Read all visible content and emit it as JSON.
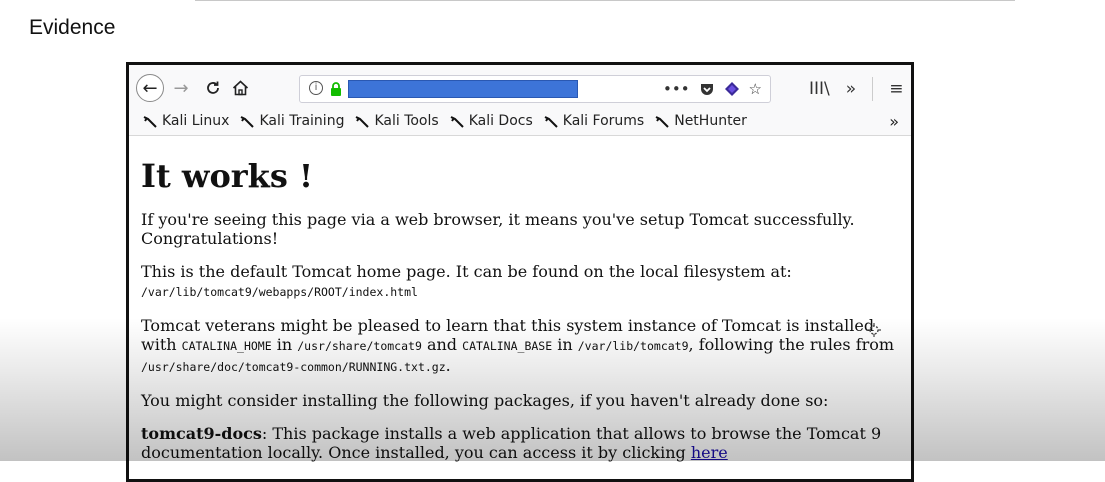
{
  "document": {
    "heading": "Evidence"
  },
  "browser": {
    "toolbar": {
      "back": "←",
      "forward": "→",
      "reload": "C",
      "home": "⌂",
      "info": "i",
      "more": "•••",
      "star": "☆",
      "library": "III\\",
      "overflow": "»",
      "menu": "≡"
    },
    "bookmarks": [
      {
        "label": "Kali Linux"
      },
      {
        "label": "Kali Training"
      },
      {
        "label": "Kali Tools"
      },
      {
        "label": "Kali Docs"
      },
      {
        "label": "Kali Forums"
      },
      {
        "label": "NetHunter"
      }
    ],
    "bookmarks_overflow": "»"
  },
  "page": {
    "title": "It works !",
    "p1": "If you're seeing this page via a web browser, it means you've setup Tomcat successfully. Congratulations!",
    "p2_text": "This is the default Tomcat home page. It can be found on the local filesystem at: ",
    "p2_path": "/var/lib/tomcat9/webapps/ROOT/index.html",
    "p3_a": "Tomcat veterans might be pleased to learn that this system instance of Tomcat is installed with ",
    "p3_catalina_home": "CATALINA_HOME",
    "p3_in1": " in ",
    "p3_path1": "/usr/share/tomcat9",
    "p3_and": " and ",
    "p3_catalina_base": "CATALINA_BASE",
    "p3_in2": " in ",
    "p3_path2": "/var/lib/tomcat9",
    "p3_rules": ", following the rules from ",
    "p3_path3": "/usr/share/doc/tomcat9-common/RUNNING.txt.gz",
    "p3_end": ".",
    "p4": "You might consider installing the following packages, if you haven't already done so:",
    "p5_bold": "tomcat9-docs",
    "p5_text": ": This package installs a web application that allows to browse the Tomcat 9 documentation locally. Once installed, you can access it by clicking ",
    "p5_link": "here"
  }
}
